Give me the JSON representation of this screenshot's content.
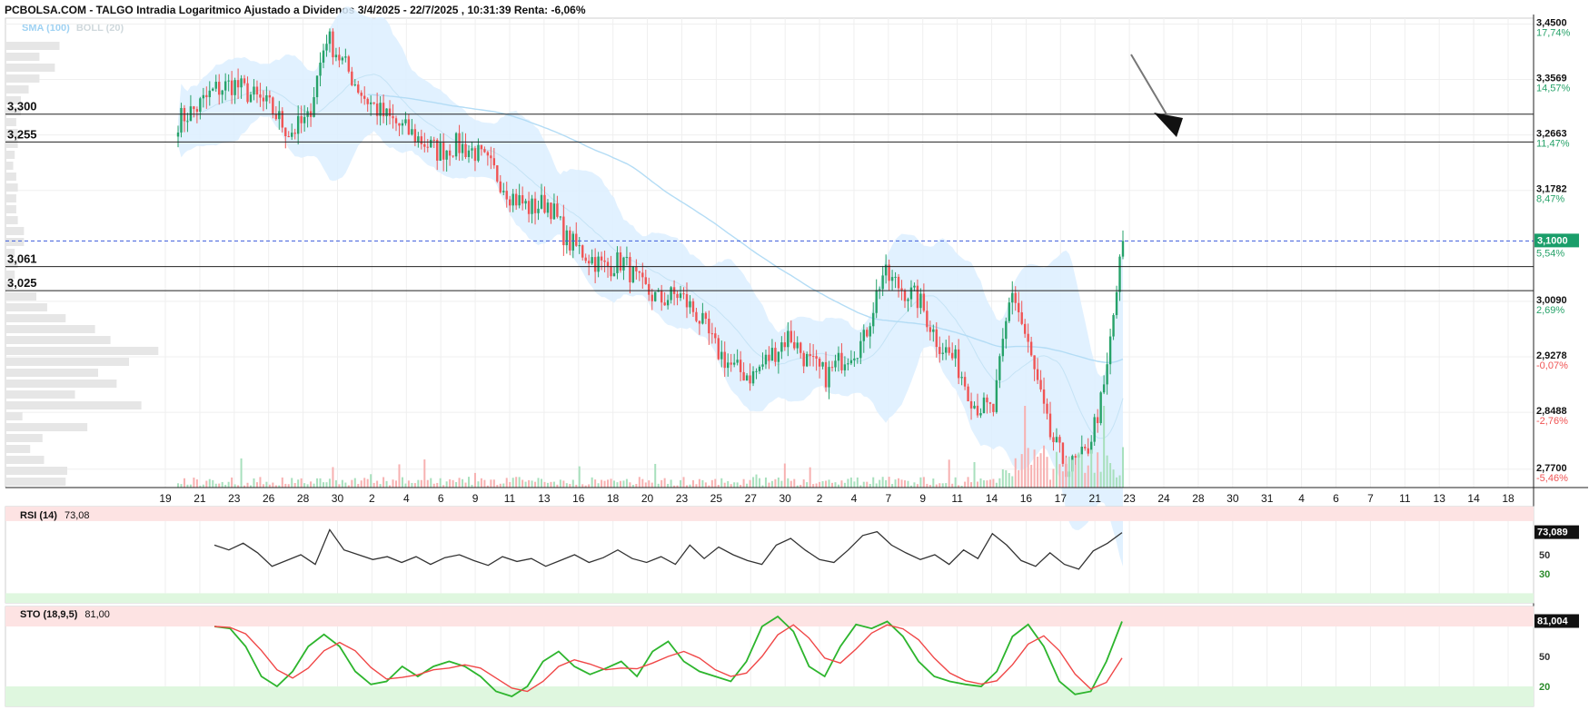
{
  "header": {
    "title": "PCBOLSA.COM - TALGO Intradia Logaritmico Ajustado a Dividenos 3/4/2025 - 22/7/2025 , 10:31:39 Renta: -6,06%",
    "sma_label": "SMA (100)",
    "boll_label": "BOLL (20)"
  },
  "colors": {
    "up": "#26a269",
    "down": "#f05454",
    "sma": "#b3dcf5",
    "boll_fill": "#dcefff",
    "current_price_bg": "#1a9e6a",
    "rsi_line": "#333333",
    "sto_k": "#2db52d",
    "sto_d": "#f04747",
    "overbought_zone": "#fde3e3",
    "oversold_zone": "#dff7df"
  },
  "chart_data": [
    {
      "type": "candlestick",
      "name": "price",
      "scale": "log",
      "ylim": [
        2.745,
        3.46
      ],
      "x_tick_labels": [
        "19",
        "21",
        "23",
        "26",
        "28",
        "30",
        "2",
        "4",
        "6",
        "9",
        "11",
        "13",
        "16",
        "18",
        "20",
        "23",
        "25",
        "27",
        "30",
        "2",
        "4",
        "7",
        "9",
        "11",
        "14",
        "16",
        "17",
        "21",
        "23",
        "24",
        "28",
        "30",
        "31",
        "4",
        "6",
        "7",
        "11",
        "13",
        "14",
        "18"
      ],
      "y_ticks": [
        {
          "price": "3,4500",
          "pct": "17,74%"
        },
        {
          "price": "3,3569",
          "pct": "14,57%"
        },
        {
          "price": "3,2663",
          "pct": "11,47%"
        },
        {
          "price": "3,1782",
          "pct": "8,47%"
        },
        {
          "price": "3,0090",
          "pct": "2,69%"
        },
        {
          "price": "2,9278",
          "pct": "-0,07%"
        },
        {
          "price": "2,8488",
          "pct": "-2,76%"
        },
        {
          "price": "2,7700",
          "pct": "-5,46%"
        }
      ],
      "current_price": {
        "label": "3,1000",
        "pct": "5,54%",
        "value": 3.1
      },
      "levels": [
        {
          "label": "3,300",
          "value": 3.3
        },
        {
          "label": "3,255",
          "value": 3.255
        },
        {
          "label": "3,061",
          "value": 3.061
        },
        {
          "label": "3,025",
          "value": 3.025
        }
      ],
      "close_path": [
        3.29,
        3.31,
        3.34,
        3.35,
        3.33,
        3.31,
        3.27,
        3.29,
        3.43,
        3.38,
        3.33,
        3.3,
        3.28,
        3.26,
        3.24,
        3.25,
        3.24,
        3.21,
        3.17,
        3.15,
        3.16,
        3.1,
        3.08,
        3.06,
        3.07,
        3.03,
        3.01,
        3.02,
        2.99,
        2.94,
        2.91,
        2.9,
        2.93,
        2.96,
        2.92,
        2.9,
        2.93,
        2.95,
        3.05,
        3.03,
        3.01,
        2.95,
        2.92,
        2.86,
        2.85,
        3.03,
        2.93,
        2.82,
        2.77,
        2.79,
        2.88,
        3.1
      ],
      "volume_profile": [
        0.35,
        0.22,
        0.32,
        0.22,
        0.15,
        0.1,
        0.1,
        0.07,
        0.08,
        0.08,
        0.06,
        0.05,
        0.07,
        0.08,
        0.07,
        0.07,
        0.08,
        0.12,
        0.12,
        0.06,
        0.08,
        0.06,
        0.05,
        0.2,
        0.27,
        0.39,
        0.58,
        0.68,
        0.99,
        0.8,
        0.6,
        0.72,
        0.45,
        0.88,
        0.11,
        0.53,
        0.24,
        0.16,
        0.25,
        0.4,
        0.39
      ]
    },
    {
      "type": "line",
      "name": "RSI (14)",
      "label": "RSI (14)",
      "last_value": "73,08",
      "axis_value": "73,089",
      "ylim": [
        0,
        100
      ],
      "levels": [
        {
          "label": "50",
          "value": 50
        },
        {
          "label": "30",
          "value": 30
        }
      ],
      "values": [
        60,
        55,
        62,
        52,
        38,
        44,
        50,
        40,
        76,
        55,
        50,
        45,
        48,
        42,
        48,
        40,
        47,
        50,
        44,
        39,
        48,
        43,
        46,
        38,
        44,
        50,
        42,
        47,
        55,
        46,
        42,
        48,
        40,
        60,
        46,
        58,
        50,
        44,
        40,
        60,
        67,
        55,
        45,
        42,
        55,
        70,
        74,
        60,
        52,
        45,
        50,
        40,
        55,
        46,
        72,
        60,
        44,
        38,
        52,
        40,
        35,
        54,
        62,
        73
      ]
    },
    {
      "type": "line",
      "name": "STO (18,9,5)",
      "label": "STO (18,9,5)",
      "last_value": "81,00",
      "axis_value": "81,004",
      "ylim": [
        0,
        100
      ],
      "levels": [
        {
          "label": "50",
          "value": 50
        },
        {
          "label": "20",
          "value": 20
        }
      ],
      "k_values": [
        80,
        78,
        60,
        30,
        20,
        35,
        60,
        72,
        60,
        35,
        22,
        25,
        40,
        30,
        40,
        45,
        40,
        30,
        15,
        10,
        20,
        45,
        55,
        40,
        32,
        38,
        45,
        30,
        55,
        65,
        45,
        35,
        30,
        25,
        45,
        80,
        90,
        75,
        40,
        30,
        60,
        82,
        78,
        85,
        70,
        45,
        30,
        25,
        22,
        20,
        35,
        70,
        82,
        60,
        25,
        12,
        15,
        45,
        85
      ]
    }
  ]
}
